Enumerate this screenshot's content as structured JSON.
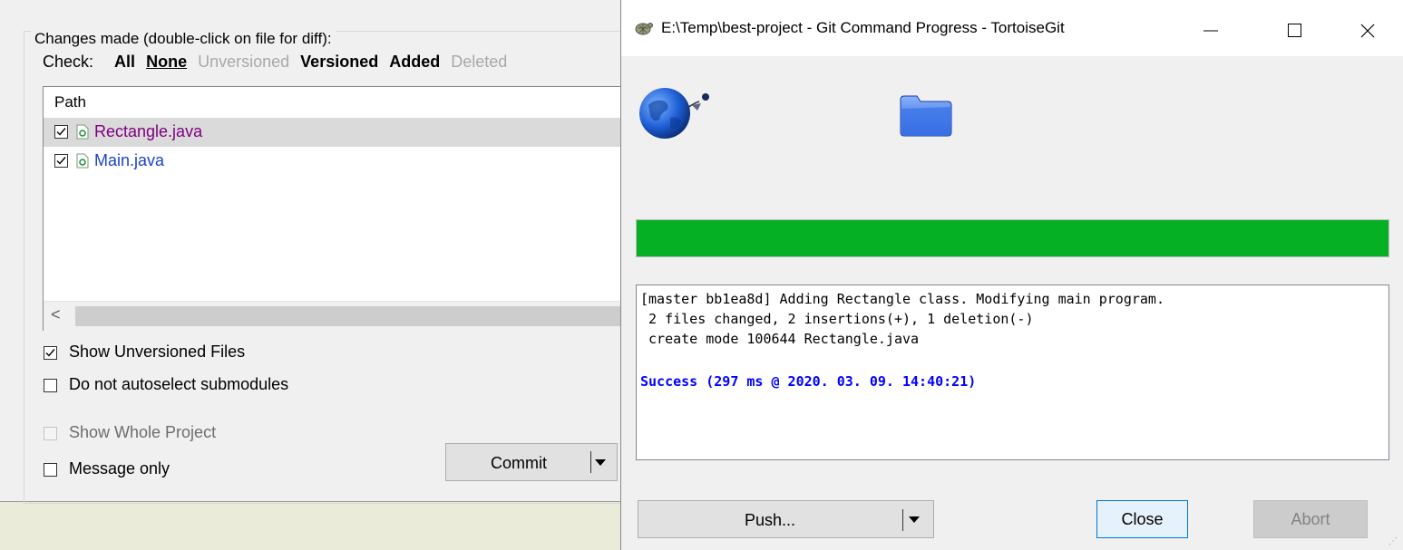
{
  "commit_dialog": {
    "group_label": "Changes made (double-click on file for diff):",
    "check_label": "Check:",
    "filters": [
      {
        "label": "All",
        "style": "bold"
      },
      {
        "label": "None",
        "style": "bold-underline"
      },
      {
        "label": "Unversioned",
        "style": "disabled"
      },
      {
        "label": "Versioned",
        "style": "bold"
      },
      {
        "label": "Added",
        "style": "bold"
      },
      {
        "label": "Deleted",
        "style": "disabled"
      }
    ],
    "list_header": "Path",
    "files": [
      {
        "name": "Rectangle.java",
        "checked": true,
        "color": "#800080",
        "selected": true
      },
      {
        "name": "Main.java",
        "checked": true,
        "color": "#1c44c8",
        "selected": false
      }
    ],
    "scroll_left": "<",
    "show_unversioned": {
      "label": "Show Unversioned Files",
      "checked": true
    },
    "no_autoselect": {
      "label": "Do not autoselect submodules",
      "checked": false
    },
    "show_whole_project": {
      "label": "Show Whole Project",
      "checked": false,
      "disabled": true
    },
    "message_only": {
      "label": "Message only",
      "checked": false
    },
    "commit_button": "Commit"
  },
  "progress_window": {
    "title": "E:\\Temp\\best-project - Git Command Progress - TortoiseGit",
    "progress_fraction": 1.0,
    "progress_color": "#06b025",
    "log_lines": [
      {
        "text": "[master bb1ea8d] Adding Rectangle class. Modifying main program.",
        "style": "normal"
      },
      {
        "text": " 2 files changed, 2 insertions(+), 1 deletion(-)",
        "style": "normal"
      },
      {
        "text": " create mode 100644 Rectangle.java",
        "style": "normal"
      },
      {
        "text": "",
        "style": "normal"
      },
      {
        "text": "Success (297 ms @ 2020. 03. 09. 14:40:21)",
        "style": "success"
      }
    ],
    "success_color": "#0000ff",
    "push_button": "Push...",
    "close_button": "Close",
    "abort_button": "Abort"
  }
}
